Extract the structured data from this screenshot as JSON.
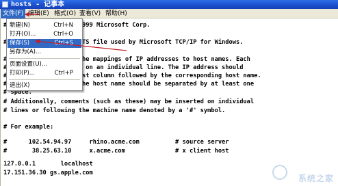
{
  "window": {
    "title": "hosts - 记事本"
  },
  "menus": [
    {
      "label": "文件(F)"
    },
    {
      "label": "编辑(E)"
    },
    {
      "label": "格式(O)"
    },
    {
      "label": "查看(V)"
    },
    {
      "label": "帮助(H)"
    }
  ],
  "file_menu": {
    "items": [
      {
        "label": "新建(N)",
        "shortcut": "Ctrl+N"
      },
      {
        "label": "打开(O)...",
        "shortcut": "Ctrl+O"
      },
      {
        "label": "保存(S)",
        "shortcut": "Ctrl+S"
      },
      {
        "label": "另存为(A)...",
        "shortcut": ""
      },
      {
        "label": "页面设置(U)...",
        "shortcut": ""
      },
      {
        "label": "打印(P)...",
        "shortcut": "Ctrl+P"
      },
      {
        "label": "退出(X)",
        "shortcut": ""
      }
    ]
  },
  "editor": {
    "lines": [
      "# Copyright (c) 1993-1999 Microsoft Corp.",
      "",
      "# This is a sample HOSTS file used by Microsoft TCP/IP for Windows.",
      "",
      "# This file contains the mappings of IP addresses to host names. Each",
      "# entry should be kept on an individual line. The IP address should",
      "# be placed in the first column followed by the corresponding host name.",
      "# The IP address and the host name should be separated by at least one",
      "# space.",
      "",
      "# Additionally, comments (such as these) may be inserted on individual",
      "# lines or following the machine name denoted by a '#' symbol.",
      "",
      "# For example:",
      "",
      "#      102.54.94.97     rhino.acme.com          # source server",
      "#       38.25.63.10     x.acme.com              # x client host",
      "",
      "127.0.0.1       localhost",
      "17.151.36.30 gs.apple.com"
    ]
  },
  "watermark": {
    "text": "系统之家"
  },
  "colors": {
    "highlight": "#316ac5",
    "annotation_arrow": "#c0202a",
    "titlebar": "#1b4fcc"
  }
}
